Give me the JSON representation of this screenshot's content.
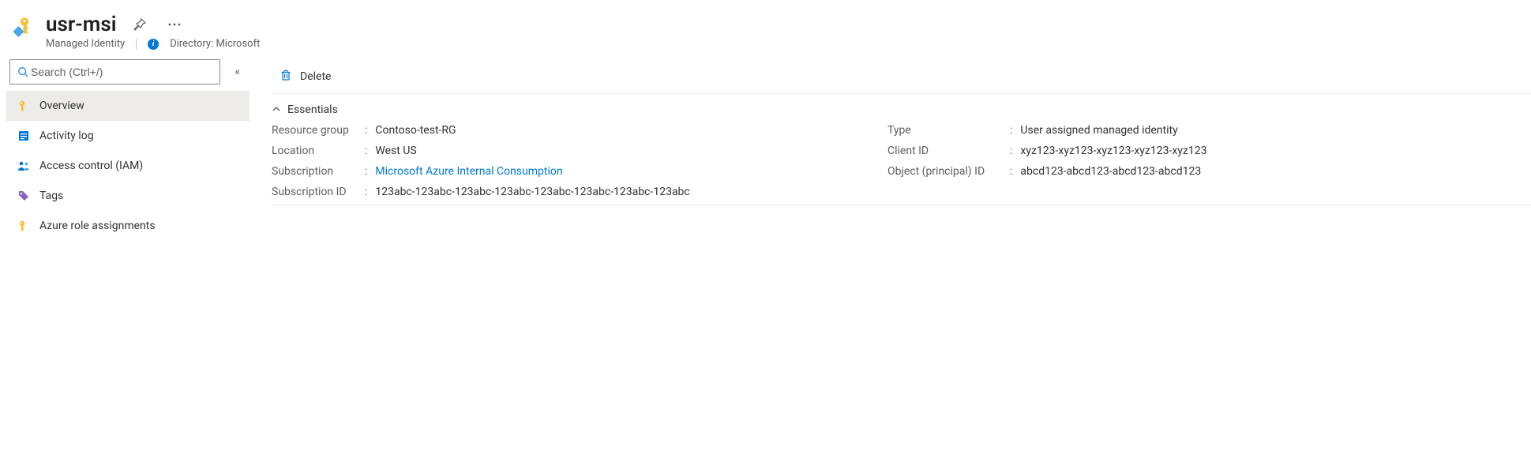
{
  "header": {
    "title": "usr-msi",
    "subtitle": "Managed Identity",
    "directory_label": "Directory: Microsoft"
  },
  "sidebar": {
    "search_placeholder": "Search (Ctrl+/)",
    "items": [
      {
        "label": "Overview",
        "icon": "key-icon",
        "selected": true
      },
      {
        "label": "Activity log",
        "icon": "log-icon",
        "selected": false
      },
      {
        "label": "Access control (IAM)",
        "icon": "people-icon",
        "selected": false
      },
      {
        "label": "Tags",
        "icon": "tag-icon",
        "selected": false
      },
      {
        "label": "Azure role assignments",
        "icon": "key-solid-icon",
        "selected": false
      }
    ]
  },
  "toolbar": {
    "delete_label": "Delete"
  },
  "essentials": {
    "section_title": "Essentials",
    "left": [
      {
        "label": "Resource group",
        "value": "Contoso-test-RG",
        "link": false
      },
      {
        "label": "Location",
        "value": "West US",
        "link": false
      },
      {
        "label": "Subscription",
        "value": "Microsoft Azure Internal Consumption",
        "link": true
      },
      {
        "label": "Subscription ID",
        "value": "123abc-123abc-123abc-123abc-123abc-123abc-123abc-123abc",
        "link": false
      }
    ],
    "right": [
      {
        "label": "Type",
        "value": "User assigned managed identity"
      },
      {
        "label": "Client ID",
        "value": "xyz123-xyz123-xyz123-xyz123-xyz123"
      },
      {
        "label": "Object (principal) ID",
        "value": "abcd123-abcd123-abcd123-abcd123"
      }
    ]
  }
}
